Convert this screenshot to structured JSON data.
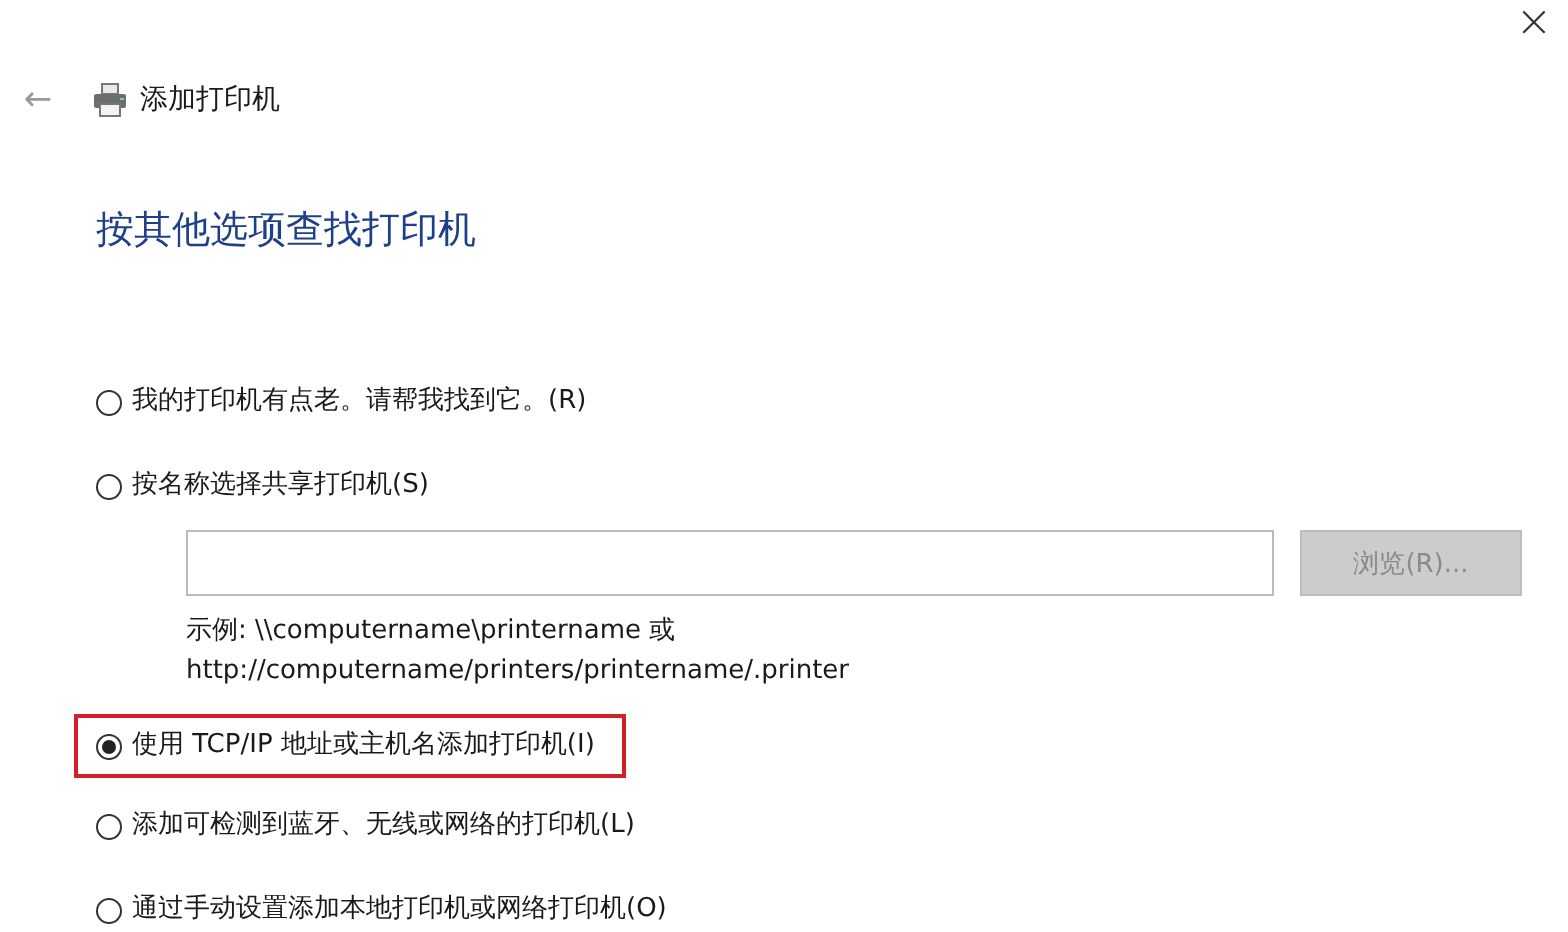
{
  "window": {
    "close": "×",
    "back": "←",
    "title": "添加打印机"
  },
  "heading": "按其他选项查找打印机",
  "options": [
    {
      "kind": "radio",
      "label": "我的打印机有点老。请帮我找到它。(R)",
      "selected": false,
      "highlighted": false
    },
    {
      "kind": "radio-with-path",
      "label": "按名称选择共享打印机(S)",
      "selected": false,
      "highlighted": false,
      "browse": {
        "label": "浏览(R)...",
        "disabled": true
      },
      "example": [
        "示例: \\\\computername\\printername 或",
        "http://computername/printers/printername/.printer"
      ]
    },
    {
      "kind": "radio",
      "label": "使用 TCP/IP 地址或主机名添加打印机(I)",
      "selected": true,
      "highlighted": true
    },
    {
      "kind": "radio",
      "label": "添加可检测到蓝牙、无线或网络的打印机(L)",
      "selected": false,
      "highlighted": false
    },
    {
      "kind": "radio",
      "label": "通过手动设置添加本地打印机或网络打印机(O)",
      "selected": false,
      "highlighted": false
    }
  ]
}
